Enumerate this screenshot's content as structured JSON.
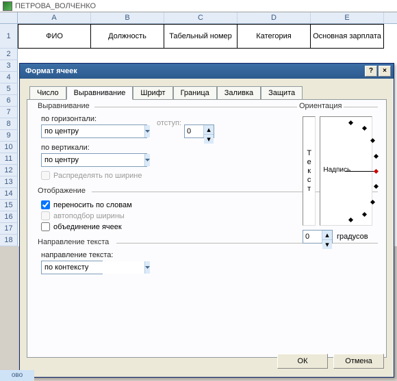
{
  "window": {
    "title": "ПЕТРОВА_ВОЛЧЕНКО"
  },
  "columns": {
    "A": "A",
    "B": "B",
    "C": "C",
    "D": "D",
    "E": "E"
  },
  "headers": {
    "A": "ФИО",
    "B": "Должность",
    "C": "Табельный номер",
    "D": "Категория",
    "E": "Основная зарплата"
  },
  "rows": [
    "1",
    "2",
    "3",
    "4",
    "5",
    "6",
    "7",
    "8",
    "9",
    "10",
    "11",
    "12",
    "13",
    "14",
    "15",
    "16",
    "17",
    "18"
  ],
  "dialog": {
    "title": "Формат ячеек",
    "help": "?",
    "close": "×",
    "tabs": {
      "number": "Число",
      "alignment": "Выравнивание",
      "font": "Шрифт",
      "border": "Граница",
      "fill": "Заливка",
      "protection": "Защита"
    },
    "align_group": "Выравнивание",
    "horiz_label": "по горизонтали:",
    "horiz_value": "по центру",
    "indent_label": "отступ:",
    "indent_value": "0",
    "vert_label": "по вертикали:",
    "vert_value": "по центру",
    "distribute": "Распределять по ширине",
    "display_group": "Отображение",
    "wrap": "переносить по словам",
    "shrink": "автоподбор ширины",
    "merge": "объединение ячеек",
    "textdir_group": "Направление текста",
    "textdir_label": "направление текста:",
    "textdir_value": "по контексту",
    "orient_group": "Ориентация",
    "orient_vtext": [
      "Т",
      "е",
      "к",
      "с",
      "т"
    ],
    "orient_label": "Надпись",
    "degrees_value": "0",
    "degrees_label": "градусов",
    "ok": "ОК",
    "cancel": "Отмена"
  },
  "status": "ово"
}
